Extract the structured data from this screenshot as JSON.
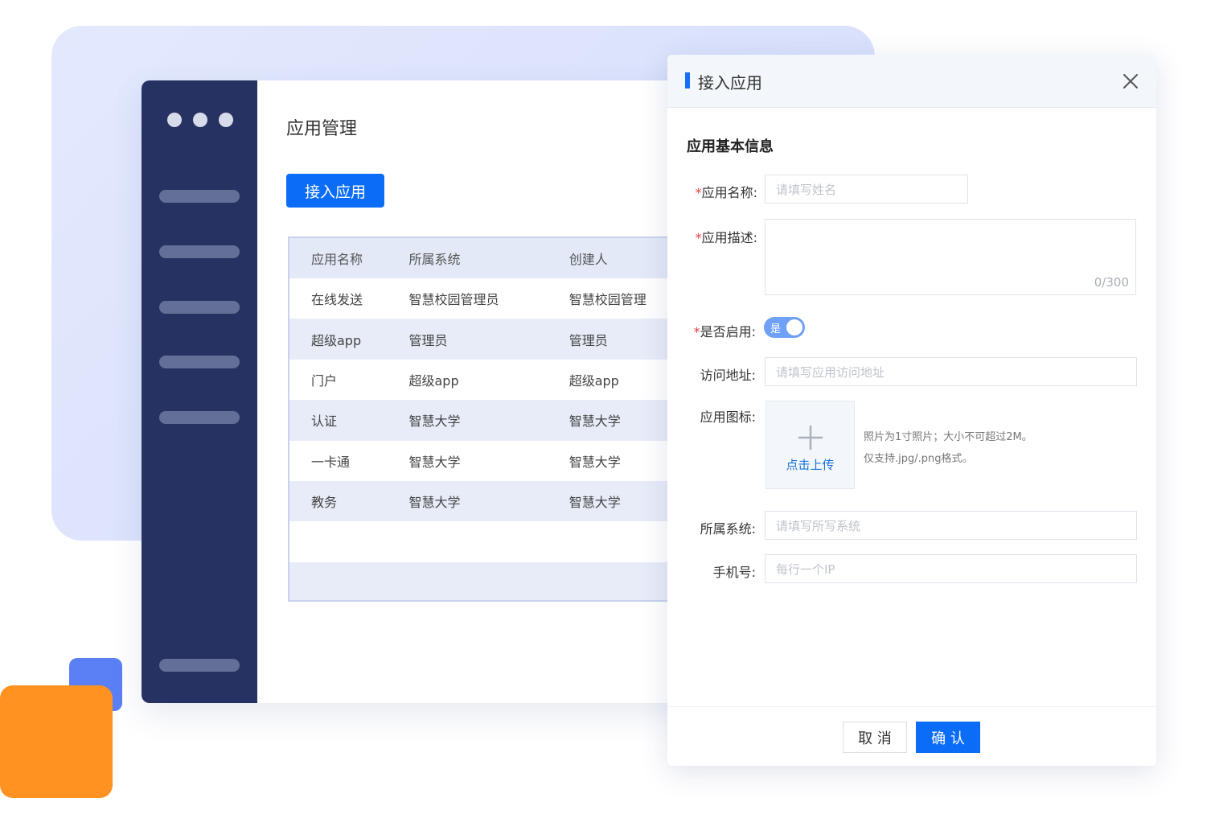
{
  "colors": {
    "accent": "#0b6cf7",
    "sidebar": "#263262",
    "lavender": "#dde4fc",
    "orange": "#ff9220",
    "decor_blue": "#5b7ff5",
    "required": "#e83a3a"
  },
  "window": {
    "title": "应用管理",
    "add_button": "接入应用",
    "table": {
      "columns": [
        "应用名称",
        "所属系统",
        "创建人"
      ],
      "rows": [
        [
          "在线发送",
          "智慧校园管理员",
          "智慧校园管理"
        ],
        [
          "超级app",
          "管理员",
          "管理员"
        ],
        [
          "门户",
          "超级app",
          "超级app"
        ],
        [
          "认证",
          "智慧大学",
          "智慧大学"
        ],
        [
          "一卡通",
          "智慧大学",
          "智慧大学"
        ],
        [
          "教务",
          "智慧大学",
          "智慧大学"
        ]
      ]
    }
  },
  "dialog": {
    "title": "接入应用",
    "close_icon": "close-icon",
    "section_title": "应用基本信息",
    "required_mark": "*",
    "name": {
      "label": "应用名称:",
      "placeholder": "请填写姓名"
    },
    "description": {
      "label": "应用描述:",
      "counter": "0/300"
    },
    "enabled": {
      "label": "是否启用:",
      "value": "是",
      "on": true
    },
    "url": {
      "label": "访问地址:",
      "placeholder": "请填写应用访问地址"
    },
    "icon": {
      "label": "应用图标:",
      "upload_text": "点击上传",
      "upload_icon": "plus-icon",
      "hint_line1": "照片为1寸照片；大小不可超过2M。",
      "hint_line2": "仅支持.jpg/.png格式。"
    },
    "system": {
      "label": "所属系统:",
      "placeholder": "请填写所写系统"
    },
    "phone": {
      "label": "手机号:",
      "placeholder": "每行一个IP"
    },
    "cancel_label": "取 消",
    "confirm_label": "确 认"
  }
}
